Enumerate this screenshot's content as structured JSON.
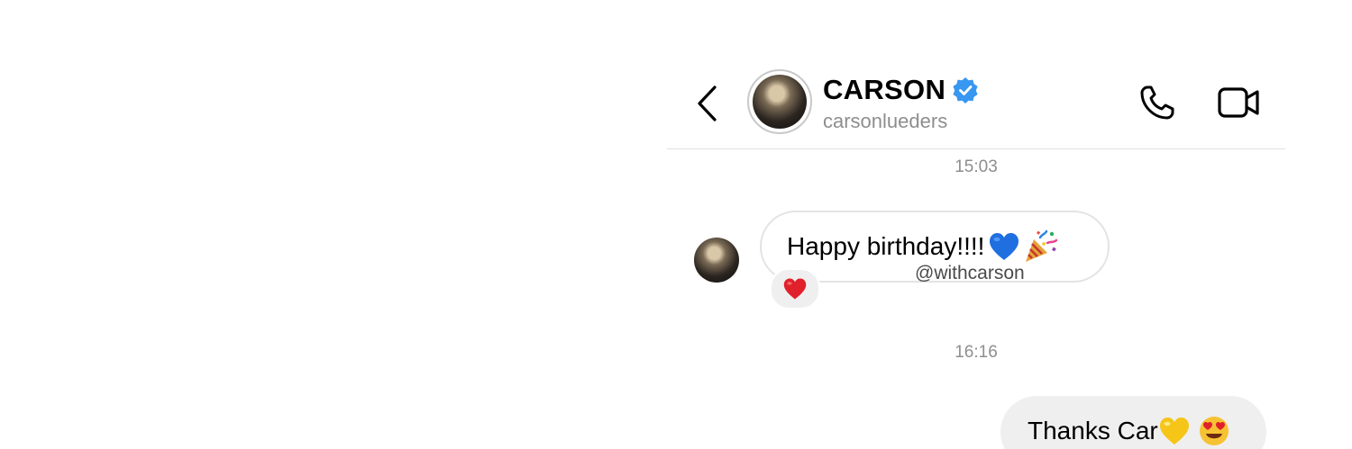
{
  "header": {
    "contact_name": "CARSON",
    "contact_handle": "carsonlueders",
    "icons": {
      "back": "chevron-left-icon",
      "verified": "verified-badge-icon",
      "call": "phone-icon",
      "video": "video-camera-icon"
    }
  },
  "messages": [
    {
      "timestamp": "15:03",
      "direction": "incoming",
      "text": "Happy birthday!!!! ",
      "emojis": [
        "blue-heart-icon",
        "party-popper-icon"
      ],
      "reaction": "red-heart-icon"
    },
    {
      "timestamp": "16:16",
      "direction": "outgoing",
      "text": "Thanks Car",
      "emojis": [
        "yellow-heart-icon",
        "heart-eyes-icon"
      ]
    }
  ],
  "watermark": "@withcarson",
  "colors": {
    "verified_blue": "#3897f0",
    "timestamp_gray": "#8e8e8e",
    "outgoing_bubble": "#efefef",
    "incoming_border": "#e3e3e3"
  }
}
